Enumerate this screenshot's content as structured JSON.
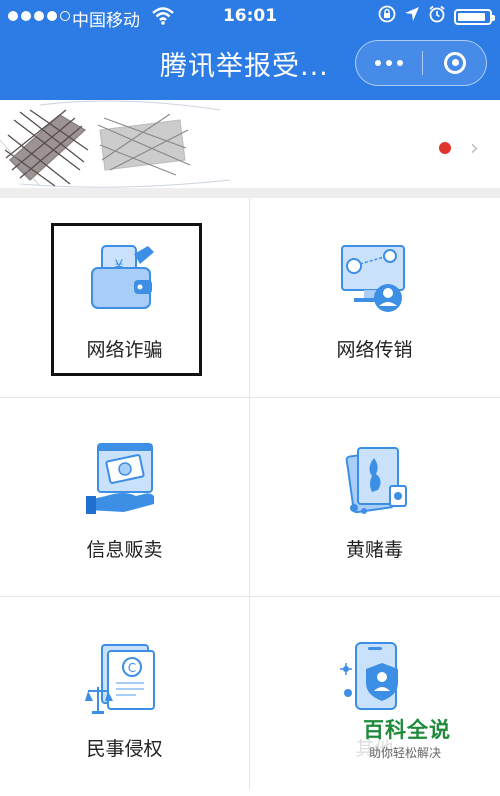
{
  "status_bar": {
    "carrier": "中国移动",
    "time": "16:01",
    "battery_level": 0.9,
    "icons": [
      "signal-dots-icon",
      "wifi-icon",
      "orientation-lock-icon",
      "location-arrow-icon",
      "alarm-icon",
      "battery-icon"
    ]
  },
  "nav": {
    "title": "腾讯举报受...",
    "more_icon": "more-dots-icon",
    "close_icon": "close-circle-icon"
  },
  "profile": {
    "notification_color": "#e0352c"
  },
  "categories": [
    {
      "label": "网络诈骗",
      "icon": "wallet-fraud-icon"
    },
    {
      "label": "网络传销",
      "icon": "network-pyramid-icon"
    },
    {
      "label": "信息贩卖",
      "icon": "data-selling-icon"
    },
    {
      "label": "黄赌毒",
      "icon": "vice-cards-icon"
    },
    {
      "label": "民事侵权",
      "icon": "copyright-scale-icon"
    },
    {
      "label": "其他",
      "icon": "shield-phone-icon"
    }
  ],
  "watermark": {
    "logo": "百科全说",
    "sub": "助你轻松解决"
  },
  "colors": {
    "header": "#2d7be5",
    "icon_blue": "#3d8fe6",
    "icon_light": "#c9e1fb"
  }
}
